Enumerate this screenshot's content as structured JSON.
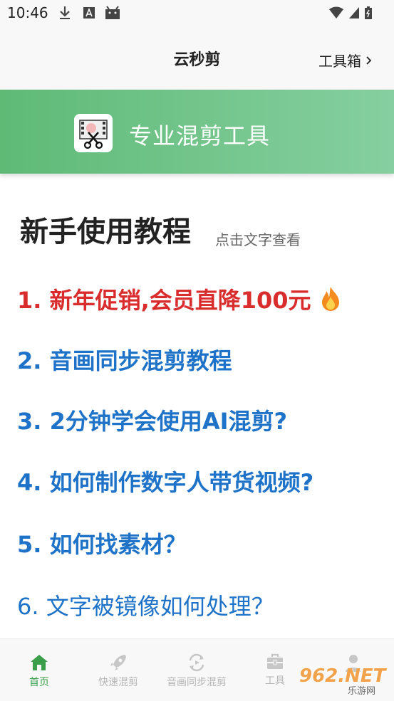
{
  "status_bar": {
    "time": "10:46"
  },
  "header": {
    "title": "云秒剪",
    "toolbox_label": "工具箱"
  },
  "banner": {
    "text": "专业混剪工具"
  },
  "tutorial": {
    "title": "新手使用教程",
    "hint": "点击文字查看",
    "items": [
      {
        "text": "1. 新年促销,会员直降100元",
        "style": "promo"
      },
      {
        "text": "2. 音画同步混剪教程",
        "style": "link"
      },
      {
        "text": "3. 2分钟学会使用AI混剪?",
        "style": "link"
      },
      {
        "text": "4. 如何制作数字人带货视频?",
        "style": "link"
      },
      {
        "text": "5. 如何找素材？",
        "style": "link"
      },
      {
        "text": "6. 文字被镜像如何处理？",
        "style": "link-light"
      }
    ]
  },
  "bottom_nav": {
    "items": [
      {
        "label": "首页",
        "icon": "home-icon",
        "active": true
      },
      {
        "label": "快速混剪",
        "icon": "rocket-icon",
        "active": false
      },
      {
        "label": "音画同步混剪",
        "icon": "sync-icon",
        "active": false
      },
      {
        "label": "工具",
        "icon": "toolbox-icon",
        "active": false
      },
      {
        "label": "",
        "icon": "user-icon",
        "active": false
      }
    ]
  },
  "watermark": {
    "text": "962.NET",
    "sub": "乐游网"
  },
  "colors": {
    "accent": "#5fba76",
    "link": "#1e73c8",
    "promo": "#d92d2d",
    "nav_active": "#3b9e4a"
  }
}
